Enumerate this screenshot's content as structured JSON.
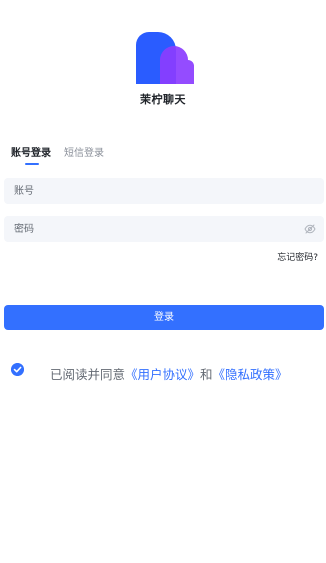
{
  "app": {
    "name": "茉柠聊天",
    "logo_colors": {
      "blue": "#2a5cff",
      "purple": "#8b3dff",
      "overlap": "#3a1fd6"
    }
  },
  "tabs": [
    {
      "label": "账号登录",
      "active": true
    },
    {
      "label": "短信登录",
      "active": false
    }
  ],
  "form": {
    "account_placeholder": "账号",
    "password_placeholder": "密码",
    "password_visibility_icon": "eye-off-icon",
    "forgot_password": "忘记密码?",
    "login_button": "登录"
  },
  "agreement": {
    "checked": true,
    "prefix": "已阅读并同意",
    "user_agreement": "《用户协议》",
    "conjunction": "和",
    "privacy_policy": "《隐私政策》"
  },
  "colors": {
    "accent": "#3370ff",
    "input_background": "#f4f6fa",
    "muted_text": "#8a8f99"
  }
}
